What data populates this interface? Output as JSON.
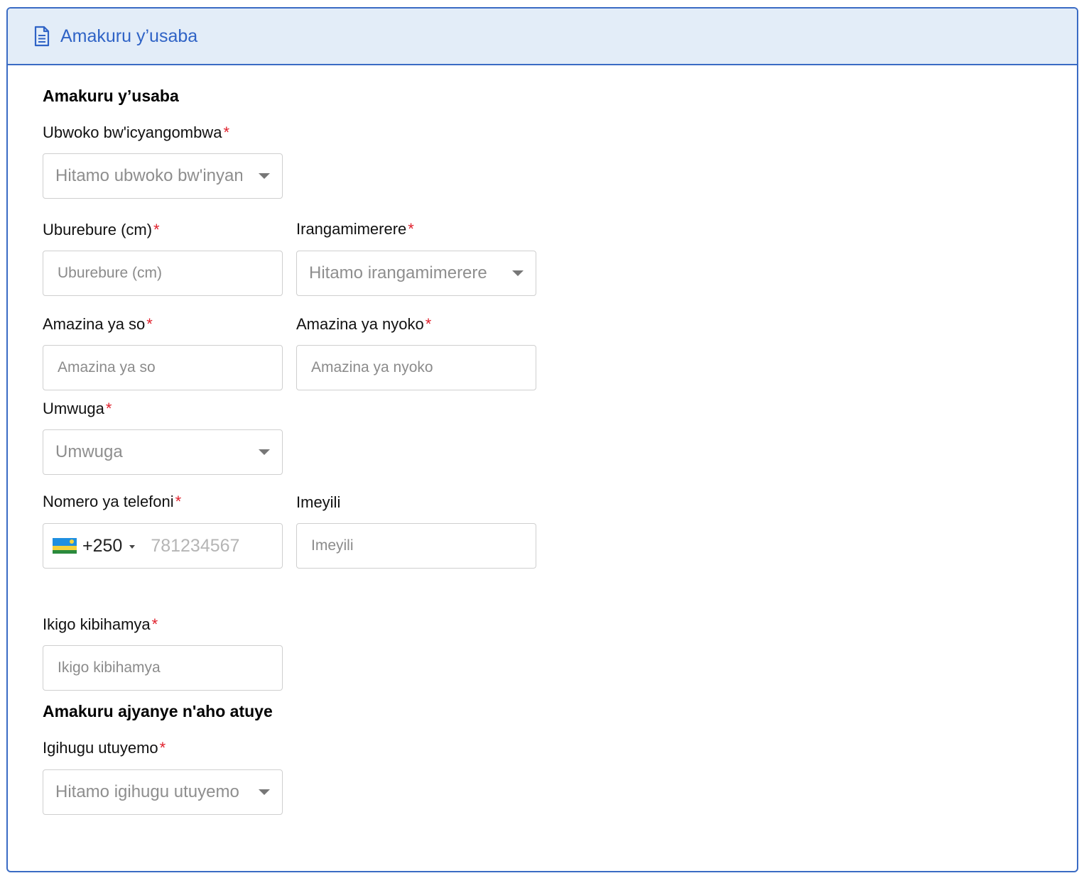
{
  "header": {
    "title": "Amakuru y’usaba",
    "icon": "document-icon"
  },
  "sections": {
    "applicant": "Amakuru y’usaba",
    "residence": "Amakuru ajyanye n'aho atuye"
  },
  "fields": {
    "plant_type": {
      "label": "Ubwoko bw'icyangombwa",
      "placeholder": "Hitamo ubwoko bw'inyandiko"
    },
    "height": {
      "label": "Uburebure (cm)",
      "placeholder": "Uburebure (cm)"
    },
    "color": {
      "label": "Irangamimerere",
      "placeholder": "Hitamo irangamimerere"
    },
    "father_name": {
      "label": "Amazina ya so",
      "placeholder": "Amazina ya so"
    },
    "mother_name": {
      "label": "Amazina ya nyoko",
      "placeholder": "Amazina ya nyoko"
    },
    "occupation": {
      "label": "Umwuga",
      "placeholder": "Umwuga"
    },
    "phone": {
      "label": "Nomero ya telefoni",
      "country_code": "+250",
      "placeholder": "781234567"
    },
    "email": {
      "label": "Imeyili",
      "placeholder": "Imeyili"
    },
    "institution": {
      "label": "Ikigo kibihamya",
      "placeholder": "Ikigo kibihamya"
    },
    "country": {
      "label": "Igihugu utuyemo",
      "placeholder": "Hitamo igihugu utuyemo"
    }
  },
  "required_marker": "*",
  "colors": {
    "accent": "#3a6bc4",
    "header_bg": "#e3edf8",
    "required": "#e0202c"
  }
}
